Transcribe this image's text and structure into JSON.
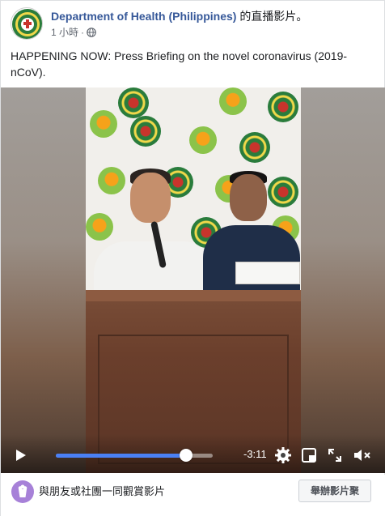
{
  "post": {
    "author_name": "Department of Health (Philippines)",
    "author_suffix": " 的直播影片。",
    "timestamp": "1 小時",
    "separator": "·",
    "text": "HAPPENING NOW: Press Briefing on the novel coronavirus (2019-nCoV)."
  },
  "video": {
    "time_remaining": "-3:11",
    "progress": 0.83,
    "icons": [
      "play-icon",
      "settings-gear-icon",
      "picture-in-picture-icon",
      "fullscreen-icon",
      "mute-speaker-icon"
    ]
  },
  "footer": {
    "watch_party_label": "與朋友或社團一同觀賞影片",
    "host_button_label": "舉辦影片聚"
  },
  "colors": {
    "link": "#365899",
    "seek_fill": "#4a80f5",
    "watch_icon": "#a781d8"
  }
}
